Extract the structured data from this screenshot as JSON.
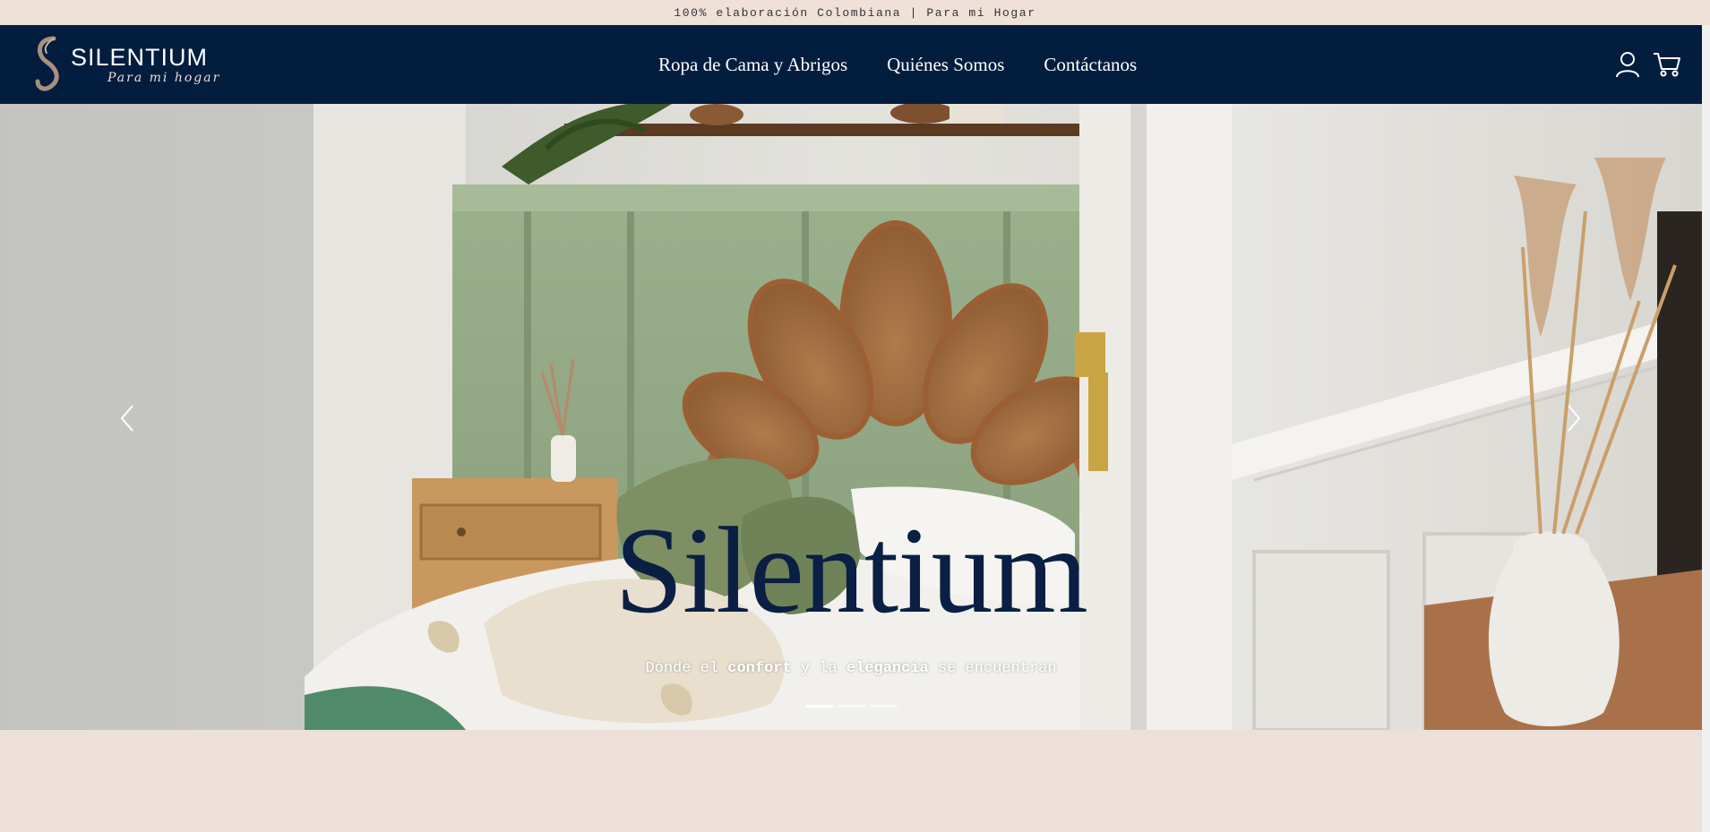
{
  "announcement": {
    "text": "100% elaboración Colombiana | Para mi Hogar"
  },
  "header": {
    "logo_name": "SILENTIUM",
    "logo_tagline": "Para mi hogar",
    "nav": [
      {
        "label": "Ropa de Cama y Abrigos"
      },
      {
        "label": "Quiénes Somos"
      },
      {
        "label": "Contáctanos"
      }
    ],
    "icons": [
      "user-icon",
      "cart-icon"
    ]
  },
  "hero": {
    "title": "Silentium",
    "subtitle_parts": [
      "Dónde el ",
      "confort",
      " y la ",
      "elegancia",
      " se encuentran"
    ],
    "slide_count": 3,
    "active_slide": 0,
    "icons": [
      "chevron-left-icon",
      "chevron-right-icon"
    ]
  },
  "colors": {
    "header_bg": "#031d3f",
    "announcement_bg": "#efe1d8",
    "page_bg": "#ede0d8",
    "hero_title": "#0a1f43"
  }
}
